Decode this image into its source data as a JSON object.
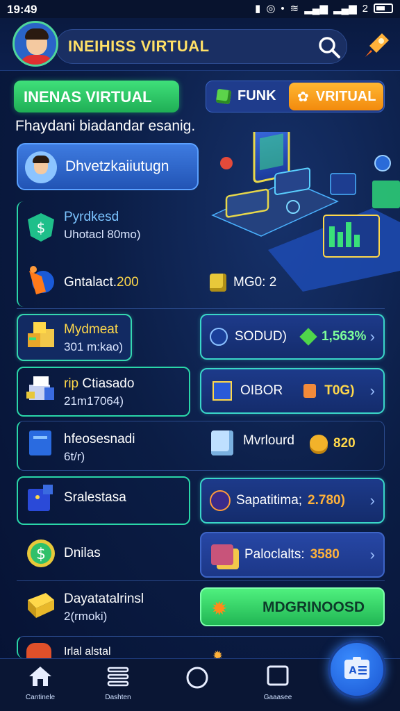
{
  "status_bar": {
    "time": "19:49",
    "battery_text": "2"
  },
  "header": {
    "title": "INEIHISS VIRTUAL"
  },
  "top_row": {
    "green_button": "INENAS VIRTUAL",
    "segment_left": "FUNK",
    "segment_right": "VRITUAL"
  },
  "subtitle": "Fhaydani biadandar esanig.",
  "profile": {
    "name": "Dhvetzkaiiutugn"
  },
  "rows": [
    {
      "title": "Pyrdkesd",
      "subtitle": "Uhotacl 80mo)"
    },
    {
      "title": "Gntalact.",
      "title_value": "200",
      "right_text": "MG0:",
      "right_value": "2"
    },
    {
      "title": "Mydmeat",
      "subtitle": "301 m:kao)",
      "right_text": "SODUD)",
      "right_value": "1,563%"
    },
    {
      "title": "rip",
      "title_rest": "Ctiasado",
      "subtitle": "21m17064)",
      "right_text": "OIBOR",
      "right_value": "T0G)"
    },
    {
      "title": "hfeosesnadi",
      "subtitle": "6t/r)",
      "right_text": "Mvrlourd",
      "right_value": "820"
    },
    {
      "title": "Sralestasa",
      "right_text": "Sapatitima;",
      "right_value": "2.780)"
    },
    {
      "title": "Dnilas",
      "right_text": "Paloclalts:",
      "right_value": "3580"
    },
    {
      "title": "Dayatatalrinsl",
      "subtitle": "2(rmoki)",
      "right_text": "MDGRINOOSD"
    },
    {
      "title": "Irlal alstal"
    }
  ],
  "bottom_nav": [
    {
      "label": "Cantinele",
      "icon": "home-icon"
    },
    {
      "label": "Dashten",
      "icon": "menu-icon"
    },
    {
      "label": "",
      "icon": "circle-icon"
    },
    {
      "label": "Gaaasee",
      "icon": "square-icon"
    }
  ],
  "fab": {
    "text": "A☰",
    "icon": "profile-card-icon"
  },
  "colors": {
    "accent_green": "#2fe07a",
    "accent_orange": "#f28a0d",
    "gold": "#ffd84a",
    "panel_blue": "#1f3c8c"
  }
}
